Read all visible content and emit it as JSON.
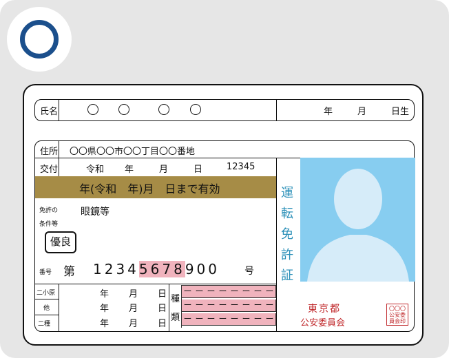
{
  "card": {
    "name_label": "氏名",
    "birth_year": "年",
    "birth_month": "月",
    "birth_day": "日生",
    "address_label": "住所",
    "address_value": "〇〇県〇〇市〇〇丁目〇〇番地",
    "issue_label": "交付",
    "issue_era": "令和",
    "issue_year": "年",
    "issue_month": "月",
    "issue_day": "日",
    "issue_number": "12345",
    "expiry_text": "年(令和　年)月　日まで有効",
    "conditions_label_1": "免許の",
    "conditions_label_2": "条件等",
    "conditions_value": "眼鏡等",
    "excellent_badge": "優良",
    "vertical_title": "運転免許証",
    "number_label": "番号",
    "number_prefix": "第",
    "number_plain_1": "1234",
    "number_highlight": "5678",
    "number_plain_2": "900",
    "number_suffix": "号",
    "rows": [
      {
        "label": "二小原",
        "year": "年",
        "month": "月",
        "day": "日"
      },
      {
        "label": "他",
        "year": "年",
        "month": "月",
        "day": "日"
      },
      {
        "label": "二種",
        "year": "年",
        "month": "月",
        "day": "日"
      }
    ],
    "type_label_1": "種",
    "type_label_2": "類",
    "type_cell": "ー",
    "issuer_1": "東京都",
    "issuer_2": "公安委員会",
    "seal_text_1": "〇〇〇",
    "seal_text_2": "公安委",
    "seal_text_3": "員会印"
  },
  "colors": {
    "ring": "#1b4f8c",
    "band": "#a68c46",
    "photo_bg": "#87cdf0",
    "silhouette": "#d6ecf9",
    "highlight": "#f0b3bd",
    "vertical_title": "#2a8fb8",
    "issuer": "#c0282b"
  }
}
